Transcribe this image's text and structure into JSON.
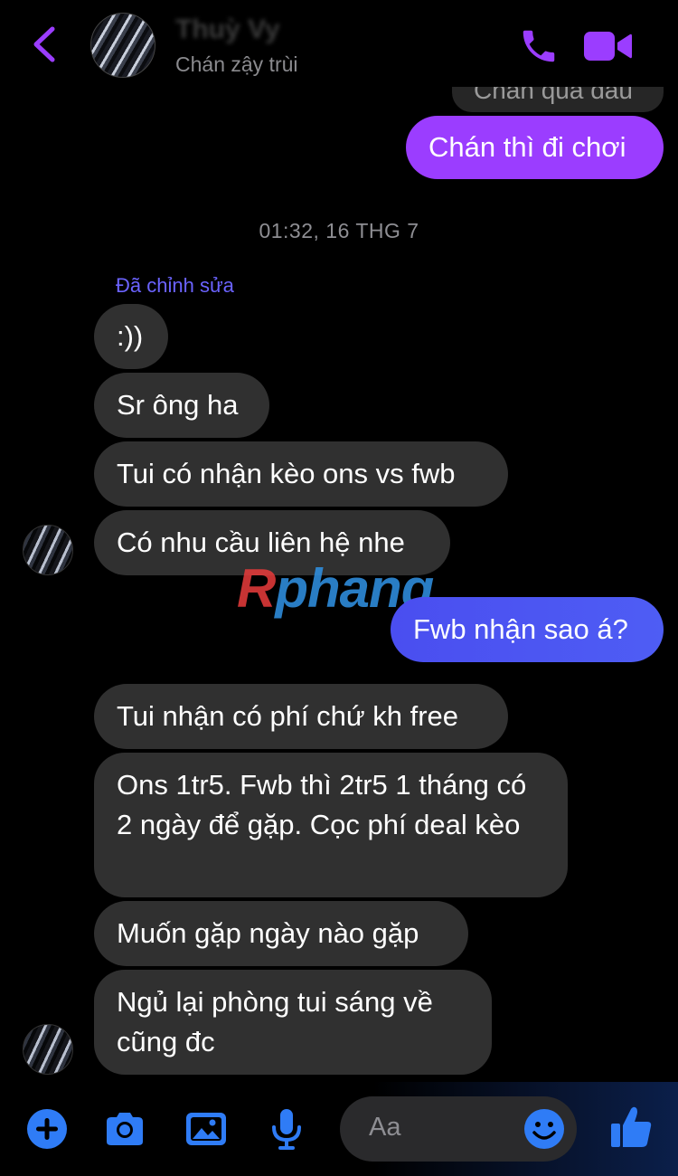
{
  "header": {
    "contact_name": "Thuỳ Vy",
    "status": "Chán zậy trùi"
  },
  "colors": {
    "accent_purple": "#9b3dff",
    "accent_blue": "#2f7cf6",
    "incoming_bubble": "#303030"
  },
  "messages": {
    "partial_top": "Chán quá đau",
    "m1": "Chán thì đi chơi",
    "timestamp": "01:32, 16 THG 7",
    "edited_label": "Đã chỉnh sửa",
    "m2": ":))",
    "m3": "Sr ông ha",
    "m4": "Tui có nhận kèo ons vs fwb",
    "m5": "Có nhu cầu liên hệ nhe",
    "m6": "Fwb nhận sao á?",
    "m7": "Tui nhận có phí chứ kh free",
    "m8": "Ons 1tr5. Fwb thì 2tr5 1 tháng có 2 ngày để gặp. Cọc phí deal kèo",
    "m9": "Muốn gặp ngày nào gặp",
    "m10": "Ngủ lại phòng tui sáng về cũng đc"
  },
  "watermark": {
    "first": "R",
    "rest": "phang"
  },
  "composer": {
    "placeholder": "Aa"
  },
  "icons": {
    "back": "chevron-left-icon",
    "call": "phone-icon",
    "video": "video-camera-icon",
    "add": "plus-circle-icon",
    "camera": "camera-icon",
    "gallery": "image-icon",
    "mic": "microphone-icon",
    "emoji": "smiley-icon",
    "like": "thumbs-up-icon"
  }
}
